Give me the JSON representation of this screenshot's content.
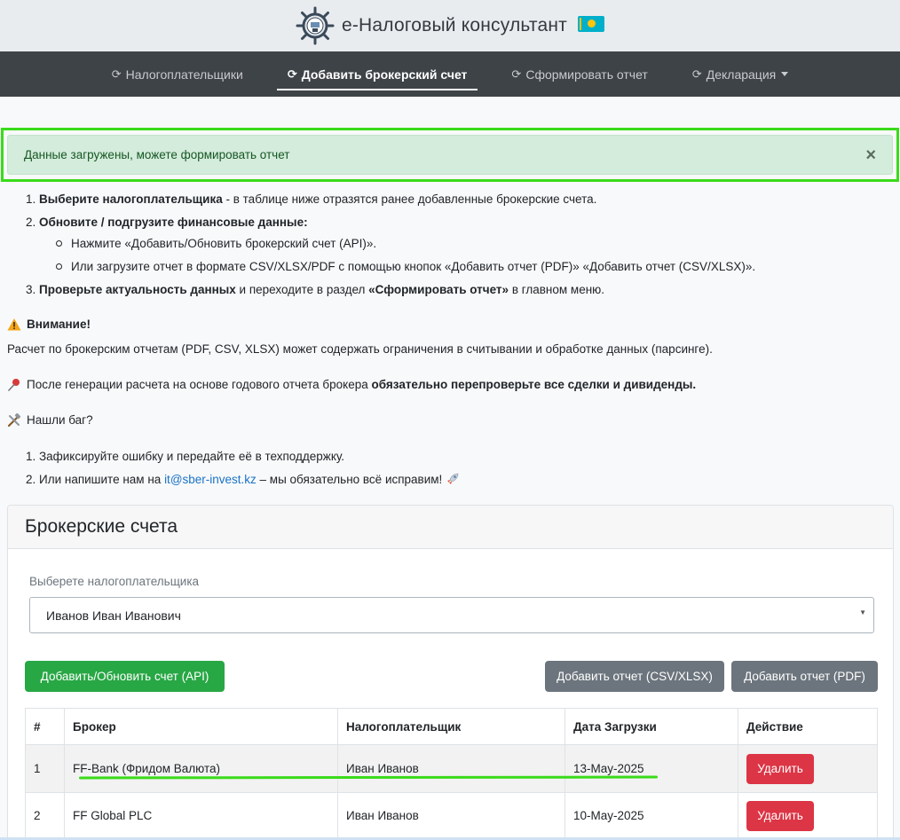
{
  "header": {
    "title": "е-Налоговый консультант",
    "logo_icon": "ship-wheel-icon",
    "flag_icon": "kazakhstan-flag-icon"
  },
  "nav": {
    "items": [
      {
        "label": "Налогоплательщики",
        "active": false
      },
      {
        "label": "Добавить брокерский счет",
        "active": true
      },
      {
        "label": "Сформировать отчет",
        "active": false
      },
      {
        "label": "Декларация",
        "active": false
      }
    ],
    "spinner_glyph": "⟳"
  },
  "alert": {
    "text": "Данные загружены, можете формировать отчет",
    "close": "×"
  },
  "instructions": {
    "step1_bold": "Выберите налогоплательщика",
    "step1_rest": " - в таблице ниже отразятся ранее добавленные брокерские счета.",
    "step2_bold": "Обновите / подгрузите финансовые данные:",
    "step2_sub1": "Нажмите «Добавить/Обновить брокерский счет (API)».",
    "step2_sub2": "Или загрузите отчет в формате CSV/XLSX/PDF с помощью кнопок «Добавить отчет (PDF)» «Добавить отчет (CSV/XLSX)».",
    "step3_bold1": "Проверьте актуальность данных",
    "step3_mid": " и переходите в раздел ",
    "step3_bold2": "«Сформировать отчет»",
    "step3_rest": " в главном меню.",
    "warning_title": "Внимание!",
    "warning_text": "Расчет по брокерским отчетам (PDF, CSV, XLSX) может содержать ограничения в считывании и обработке данных (парсинге).",
    "pin_text": "После генерации расчета на основе годового отчета брокера ",
    "pin_bold": "обязательно перепроверьте все сделки и дивиденды.",
    "bug_title": "Нашли баг?",
    "bug_step1": "Зафиксируйте ошибку и передайте её в техподдержку.",
    "bug_step2_pre": "Или напишите нам на ",
    "bug_email": "it@sber-invest.kz",
    "bug_step2_post": " – мы обязательно всё исправим! "
  },
  "card": {
    "title": "Брокерские счета",
    "select_label": "Выберете налогоплательщика",
    "select_value": "Иванов Иван Иванович",
    "btn_api": "Добавить/Обновить счет (API)",
    "btn_csv": "Добавить отчет (CSV/XLSX)",
    "btn_pdf": "Добавить отчет (PDF)"
  },
  "table": {
    "headers": [
      "#",
      "Брокер",
      "Налогоплательщик",
      "Дата Загрузки",
      "Действие"
    ],
    "rows": [
      {
        "num": "1",
        "broker": "FF-Bank (Фридом Валюта)",
        "payer": "Иван Иванов",
        "date": "13-May-2025",
        "action": "Удалить"
      },
      {
        "num": "2",
        "broker": "FF Global PLC",
        "payer": "Иван Иванов",
        "date": "10-May-2025",
        "action": "Удалить"
      }
    ]
  }
}
